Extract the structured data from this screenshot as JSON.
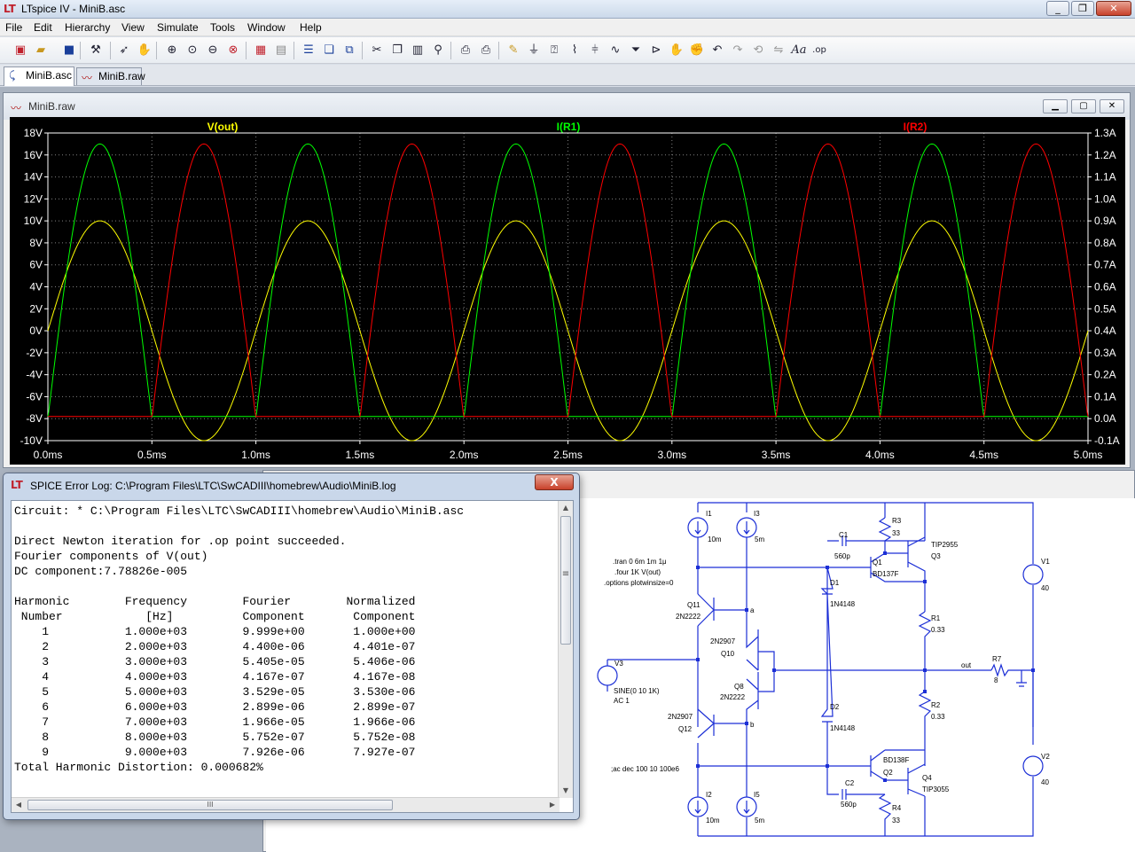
{
  "app": {
    "title": "LTspice IV - MiniB.asc"
  },
  "menu": [
    "File",
    "Edit",
    "Hierarchy",
    "View",
    "Simulate",
    "Tools",
    "Window",
    "Help"
  ],
  "toolbar": {
    "icons": [
      "new-schematic-icon",
      "open-icon",
      "save-icon",
      "control-panel-icon",
      "run-icon",
      "halt-icon",
      "zoom-in-icon",
      "zoom-pan-icon",
      "zoom-out-icon",
      "zoom-fit-icon",
      "autorange-icon",
      "tile-icon",
      "cascade-icon",
      "close-all-icon",
      "cut-icon",
      "copy-icon",
      "paste-icon",
      "find-icon",
      "print-setup-icon",
      "print-icon",
      "wire-icon",
      "ground-icon",
      "label-icon",
      "resistor-icon",
      "capacitor-icon",
      "inductor-icon",
      "diode-icon",
      "component-icon",
      "move-icon",
      "drag-icon",
      "undo-icon",
      "redo-icon",
      "rotate-icon",
      "mirror-icon",
      "text-icon",
      "spice-directive-icon"
    ]
  },
  "tabs": [
    {
      "label": "MiniB.asc",
      "active": true
    },
    {
      "label": "MiniB.raw",
      "active": false
    }
  ],
  "wave_window": {
    "title": "MiniB.raw"
  },
  "chart_data": {
    "type": "line",
    "xlabel": "",
    "x_ticks": [
      "0.0ms",
      "0.5ms",
      "1.0ms",
      "1.5ms",
      "2.0ms",
      "2.5ms",
      "3.0ms",
      "3.5ms",
      "4.0ms",
      "4.5ms",
      "5.0ms"
    ],
    "xlim": [
      0,
      5
    ],
    "left_ticks": [
      "18V",
      "16V",
      "14V",
      "12V",
      "10V",
      "8V",
      "6V",
      "4V",
      "2V",
      "0V",
      "-2V",
      "-4V",
      "-6V",
      "-8V",
      "-10V"
    ],
    "left_ylim": [
      -10,
      18
    ],
    "right_ticks": [
      "1.3A",
      "1.2A",
      "1.1A",
      "1.0A",
      "0.9A",
      "0.8A",
      "0.7A",
      "0.6A",
      "0.5A",
      "0.4A",
      "0.3A",
      "0.2A",
      "0.1A",
      "0.0A",
      "-0.1A"
    ],
    "right_ylim": [
      -0.1,
      1.3
    ],
    "grid": true,
    "series": [
      {
        "name": "V(out)",
        "color": "#ffff00",
        "axis": "left",
        "kind": "sine",
        "amplitude": 10,
        "offset": 0,
        "freq_khz": 1
      },
      {
        "name": "I(R1)",
        "color": "#00ff00",
        "axis": "right",
        "kind": "half-positive",
        "peak": 1.25,
        "floor": 0.01,
        "freq_khz": 1
      },
      {
        "name": "I(R2)",
        "color": "#ff0000",
        "axis": "right",
        "kind": "half-negative",
        "peak": 1.25,
        "floor": 0.01,
        "freq_khz": 1
      }
    ]
  },
  "error_log": {
    "title": "SPICE Error Log: C:\\Program Files\\LTC\\SwCADIII\\homebrew\\Audio\\MiniB.log",
    "close_label": "X",
    "lines": [
      "Circuit: * C:\\Program Files\\LTC\\SwCADIII\\homebrew\\Audio\\MiniB.asc",
      "",
      "Direct Newton iteration for .op point succeeded.",
      "Fourier components of V(out)",
      "DC component:7.78826e-005",
      "",
      "Harmonic        Frequency        Fourier        Normalized",
      " Number            [Hz]          Component       Component",
      "    1           1.000e+03        9.999e+00       1.000e+00",
      "    2           2.000e+03        4.400e-06       4.401e-07",
      "    3           3.000e+03        5.405e-05       5.406e-06",
      "    4           4.000e+03        4.167e-07       4.167e-08",
      "    5           5.000e+03        3.529e-05       3.530e-06",
      "    6           6.000e+03        2.899e-06       2.899e-07",
      "    7           7.000e+03        1.966e-05       1.966e-06",
      "    8           8.000e+03        5.752e-07       5.752e-08",
      "    9           9.000e+03        7.926e-06       7.927e-07",
      "Total Harmonic Distortion: 0.000682%"
    ],
    "hscroll_grip": "III",
    "vscroll_grip": "≡"
  },
  "schematic": {
    "directives": [
      ".tran 0 6m 1m 1μ",
      ".four 1K V(out)",
      ".options plotwinsize=0"
    ],
    "ac_comment": ";ac dec 100 10 100e6",
    "labels": {
      "I1": "I1",
      "I1_val": "10m",
      "I3": "I3",
      "I3_val": "5m",
      "I2": "I2",
      "I2_val": "10m",
      "I5": "I5",
      "I5_val": "5m",
      "V1": "V1",
      "V1_val": "40",
      "V2": "V2",
      "V2_val": "40",
      "V3": "V3",
      "V3_val1": "SINE(0 10 1K)",
      "V3_val2": "AC 1",
      "Q11": "Q11",
      "Q11_model": "2N2222",
      "Q12": "Q12",
      "Q12_model": "2N2907",
      "Q10": "Q10",
      "Q10_model": "2N2907",
      "Q8": "Q8",
      "Q8_model": "2N2222",
      "Q1": "Q1",
      "Q1_model": "BD137F",
      "Q2": "Q2",
      "Q2_model": "BD138F",
      "Q3": "Q3",
      "Q3_model": "TIP2955",
      "Q4": "Q4",
      "Q4_model": "TIP3055",
      "C1": "C1",
      "C1_val": "560p",
      "C2": "C2",
      "C2_val": "560p",
      "D1": "D1",
      "D1_model": "1N4148",
      "D2": "D2",
      "D2_model": "1N4148",
      "R1": "R1",
      "R1_val": "0.33",
      "R2": "R2",
      "R2_val": "0.33",
      "R3": "R3",
      "R3_val": "33",
      "R4": "R4",
      "R4_val": "33",
      "R7": "R7",
      "R7_val": "8",
      "net_a": "a",
      "net_b": "b",
      "net_out": "out"
    }
  }
}
